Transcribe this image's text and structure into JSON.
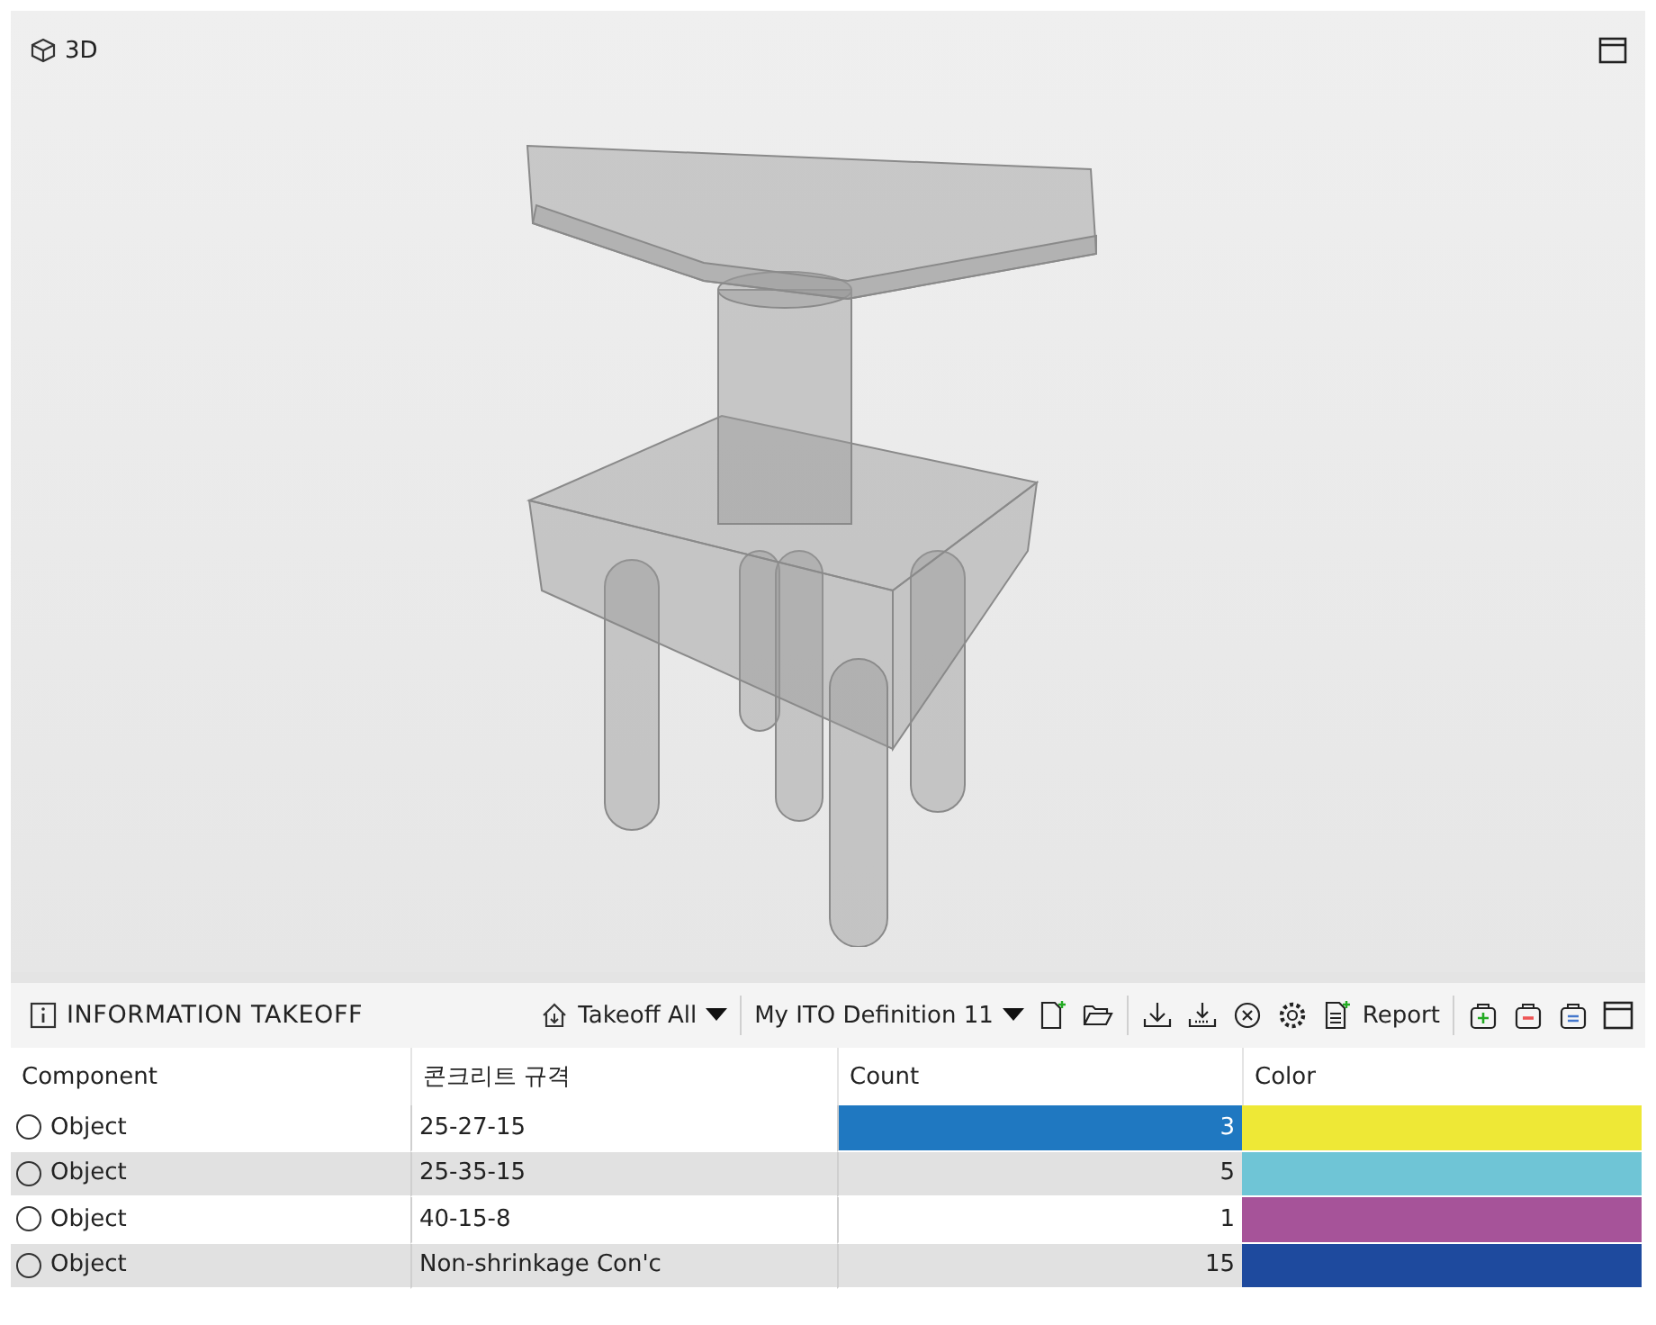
{
  "view": {
    "title": "3D"
  },
  "takeoff": {
    "title": "INFORMATION TAKEOFF",
    "scope": "Takeoff All",
    "definition": "My ITO Definition 11",
    "report": "Report",
    "table": {
      "columns": [
        "Component",
        "콘크리트 규격",
        "Count",
        "Color"
      ],
      "rows": [
        {
          "component": "Object",
          "spec": "25-27-15",
          "count": "3",
          "color": "#eee836",
          "selected": true,
          "checked": false
        },
        {
          "component": "Object",
          "spec": "25-35-15",
          "count": "5",
          "color": "#6fc5d6",
          "selected": false,
          "checked": false
        },
        {
          "component": "Object",
          "spec": "40-15-8",
          "count": "1",
          "color": "#a65399",
          "selected": false,
          "checked": false
        },
        {
          "component": "Object",
          "spec": "Non-shrinkage Con'c",
          "count": "15",
          "color": "#1e4a9e",
          "selected": false,
          "checked": false
        }
      ]
    }
  }
}
